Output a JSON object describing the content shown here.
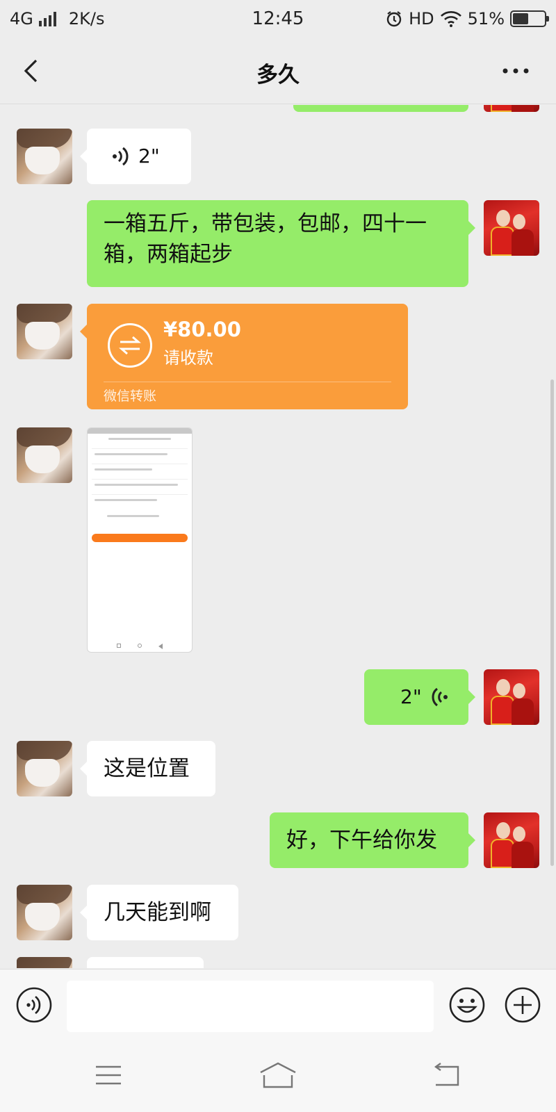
{
  "status_bar": {
    "network": "4G",
    "speed": "2K/s",
    "time": "12:45",
    "hd": "HD",
    "battery": "51%",
    "battery_level": 0.51
  },
  "header": {
    "title": "多久",
    "back_icon": "chevron-left-icon",
    "more_icon": "more-dots-icon"
  },
  "messages": [
    {
      "type": "voice",
      "direction": "incoming",
      "duration": "2\""
    },
    {
      "type": "text",
      "direction": "outgoing",
      "text": "一箱五斤，带包装，包邮，四十一箱，两箱起步"
    },
    {
      "type": "transfer",
      "direction": "incoming",
      "amount": "¥80.00",
      "note": "请收款",
      "footer": "微信转账"
    },
    {
      "type": "image",
      "direction": "incoming",
      "description": "screenshot"
    },
    {
      "type": "voice",
      "direction": "outgoing",
      "duration": "2\""
    },
    {
      "type": "text",
      "direction": "incoming",
      "text": "这是位置"
    },
    {
      "type": "text",
      "direction": "outgoing",
      "text": "好，下午给你发"
    },
    {
      "type": "text",
      "direction": "incoming",
      "text": "几天能到啊"
    }
  ],
  "input_bar": {
    "voice_icon": "voice-mode-icon",
    "emoji_icon": "emoji-icon",
    "add_icon": "plus-circle-icon",
    "value": ""
  },
  "system_nav": {
    "menu_icon": "menu-icon",
    "home_icon": "home-icon",
    "back_icon": "back-arrow-icon"
  },
  "colors": {
    "background": "#ededed",
    "outgoing_bubble": "#95ec69",
    "incoming_bubble": "#ffffff",
    "transfer_card": "#fa9d3b"
  }
}
